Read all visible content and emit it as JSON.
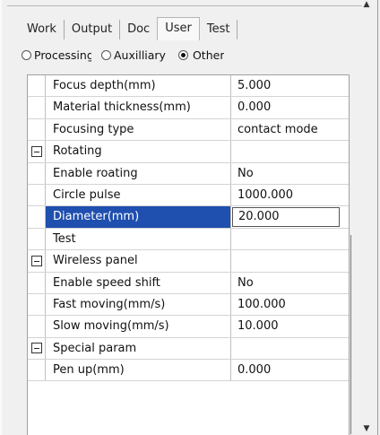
{
  "tabs": [
    {
      "label": "Work"
    },
    {
      "label": "Output"
    },
    {
      "label": "Doc"
    },
    {
      "label": "User"
    },
    {
      "label": "Test"
    }
  ],
  "active_tab": "User",
  "radio_options": [
    {
      "label": "Processing",
      "checked": false
    },
    {
      "label": "Auxilliary",
      "checked": false
    },
    {
      "label": "Other",
      "checked": true
    }
  ],
  "grid": {
    "rows": [
      {
        "name": "Focus depth(mm)",
        "value": "5.000"
      },
      {
        "name": "Material thickness(mm)",
        "value": "0.000"
      },
      {
        "name": "Focusing type",
        "value": "contact mode"
      },
      {
        "name": "Rotating",
        "value": "",
        "group": true
      },
      {
        "name": "Enable roating",
        "value": "No"
      },
      {
        "name": "Circle pulse",
        "value": "1000.000"
      },
      {
        "name": "Diameter(mm)",
        "value": "20.000",
        "selected": true
      },
      {
        "name": "Test",
        "value": ""
      },
      {
        "name": "Wireless panel",
        "value": "",
        "group": true
      },
      {
        "name": "Enable speed shift",
        "value": "No"
      },
      {
        "name": "Fast moving(mm/s)",
        "value": "100.000"
      },
      {
        "name": "Slow moving(mm/s)",
        "value": "10.000"
      },
      {
        "name": "Special param",
        "value": "",
        "group": true
      },
      {
        "name": "Pen up(mm)",
        "value": "0.000"
      }
    ]
  },
  "icons": {
    "collapse": "minus-box-icon",
    "scroll_up": "scroll-up-arrow-icon",
    "scroll_down": "scroll-down-arrow-icon"
  },
  "colors": {
    "selection": "#1f4faf",
    "background": "#f0f0f0"
  }
}
